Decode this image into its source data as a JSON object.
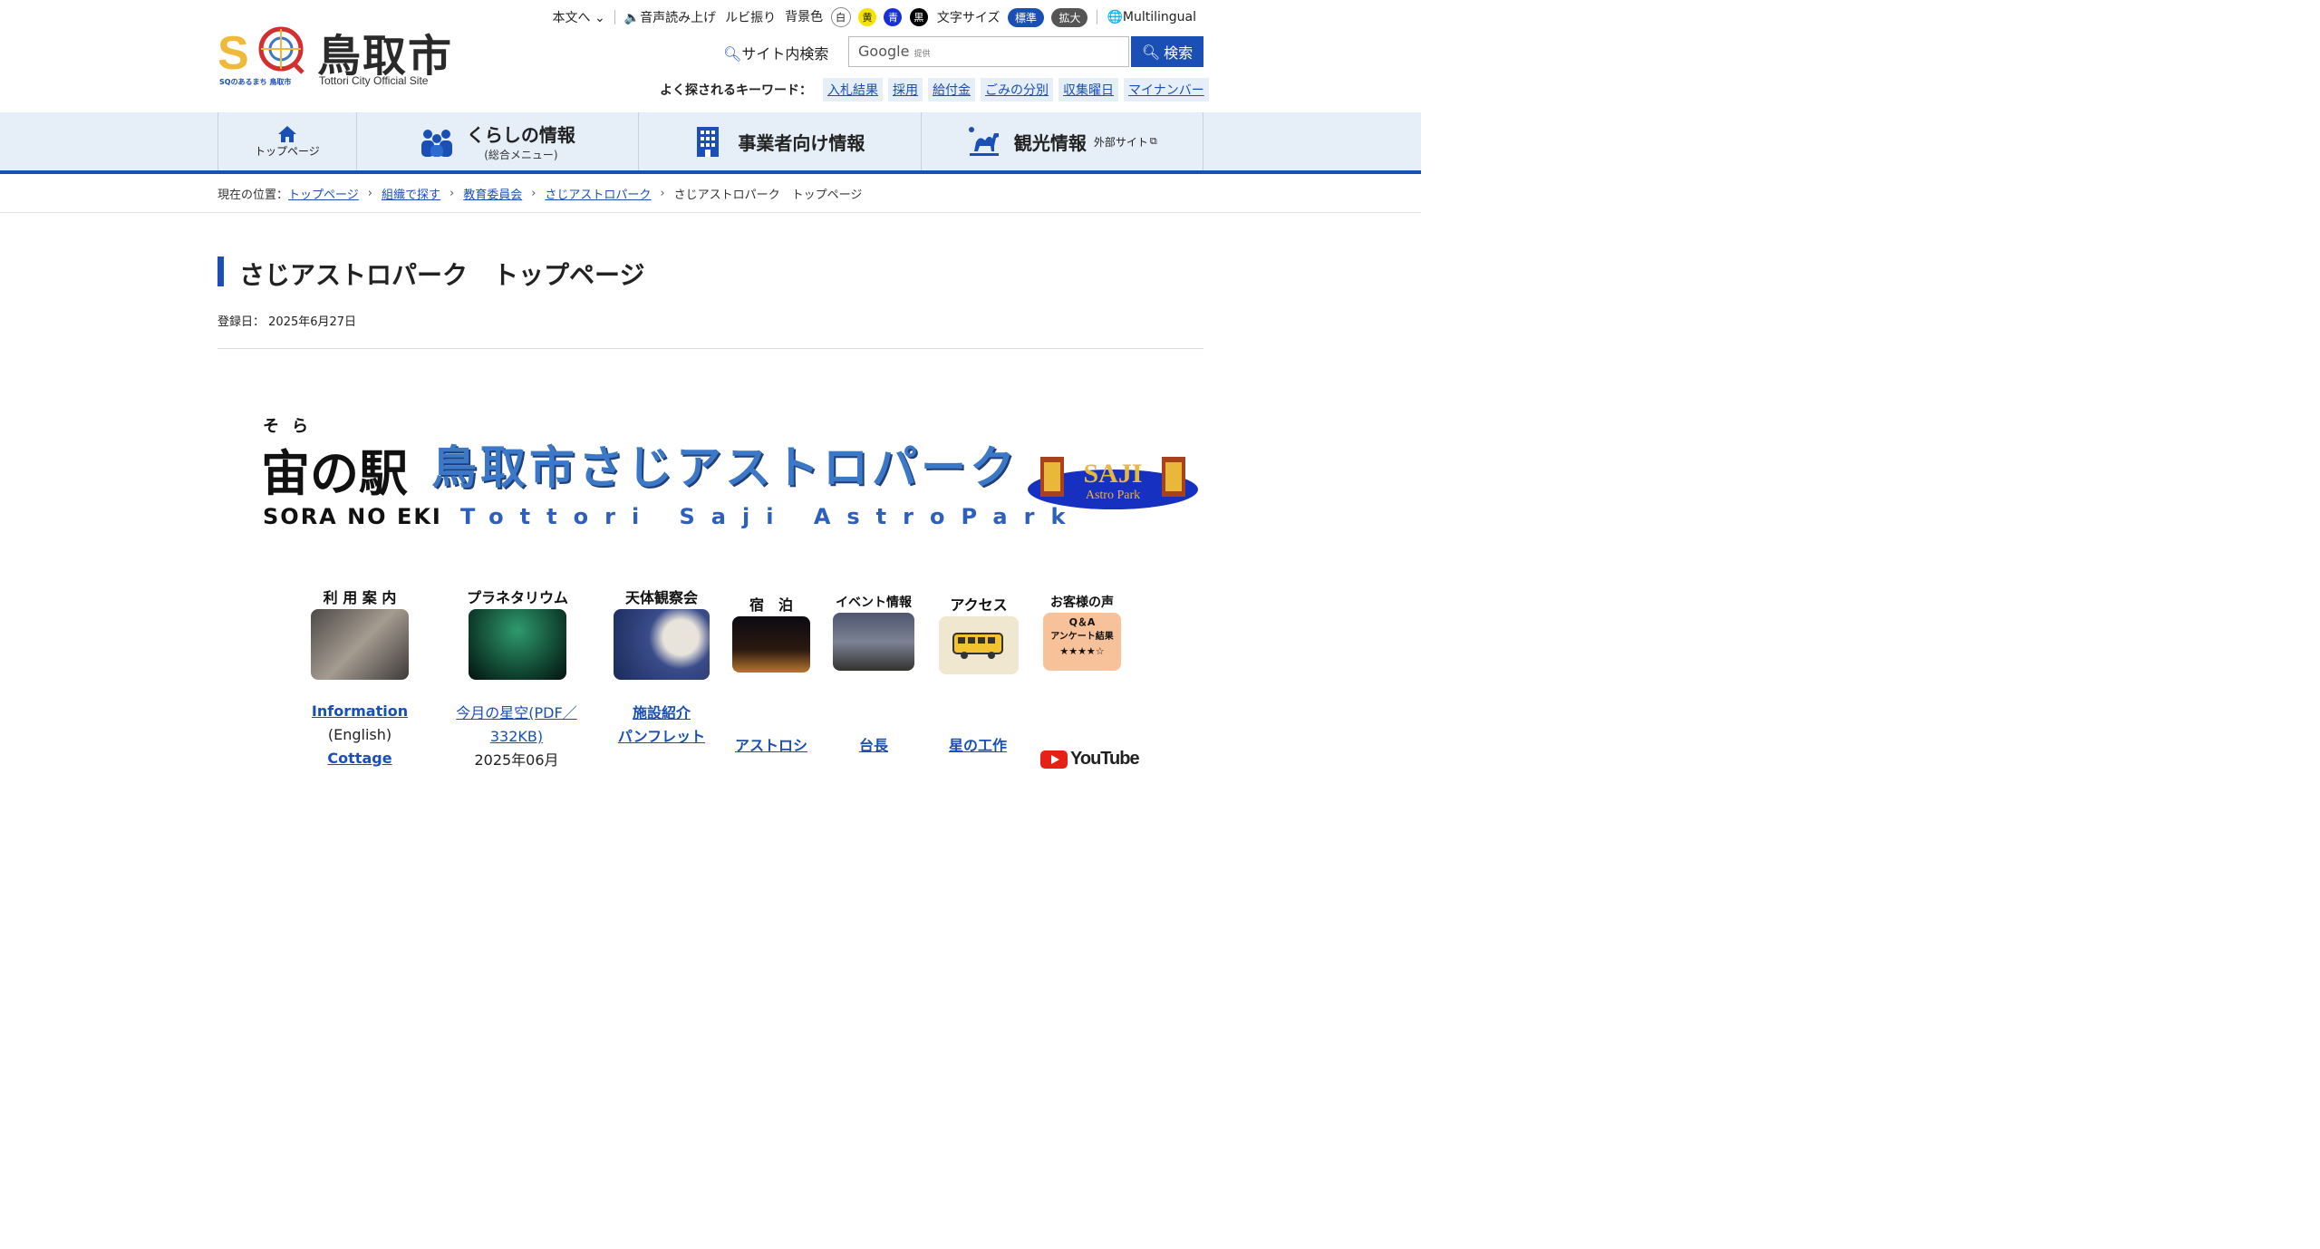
{
  "header": {
    "logo_name": "鳥取市",
    "logo_en": "Tottori City Official Site",
    "logo_sub": "SQのあるまち 鳥取市",
    "skip_link": "本文へ",
    "voice": "音声読み上げ",
    "ruby": "ルビ振り",
    "bg_label": "背景色",
    "bg_options": [
      "白",
      "黄",
      "青",
      "黒"
    ],
    "font_label": "文字サイズ",
    "font_standard": "標準",
    "font_large": "拡大",
    "multilingual": "Multilingual",
    "search_label": "サイト内検索",
    "search_placeholder_brand": "Google",
    "search_placeholder_note": "提供",
    "search_button": "検索",
    "keywords_label": "よく探されるキーワード：",
    "keywords": [
      "入札結果",
      "採用",
      "給付金",
      "ごみの分別",
      "収集曜日",
      "マイナンバー"
    ]
  },
  "nav": {
    "home": "トップページ",
    "life_title": "くらしの情報",
    "life_sub": "(総合メニュー)",
    "business": "事業者向け情報",
    "tourism": "観光情報",
    "tourism_ext": "外部サイト"
  },
  "breadcrumb": {
    "label": "現在の位置：",
    "items": [
      "トップページ",
      "組織で探す",
      "教育委員会",
      "さじアストロパーク"
    ],
    "current": "さじアストロパーク　トップページ"
  },
  "page": {
    "title": "さじアストロパーク　トップページ",
    "registered_label": "登録日：",
    "registered_date": "2025年6月27日"
  },
  "banner": {
    "ruby": "そら",
    "main": "宙の駅",
    "romaji": "SORA NO EKI",
    "jp": "鳥取市さじアストロパーク",
    "en": "Tottori Saji AstroPark",
    "badge_title": "SAJI",
    "badge_sub": "Astro Park"
  },
  "tiles": [
    {
      "label": "利 用 案 内"
    },
    {
      "label": "プラネタリウム"
    },
    {
      "label": "天体観察会"
    },
    {
      "label": "宿　泊"
    },
    {
      "label": "イベント情報"
    },
    {
      "label": "アクセス"
    },
    {
      "label": "お客様の声",
      "img_text1": "Q＆A",
      "img_text2": "アンケート結果",
      "img_text3": "★★★★☆"
    }
  ],
  "links": {
    "information": "Information",
    "english": "(English)",
    "cottage": "Cottage",
    "starsky": "今月の星空(PDF／",
    "starsky_size": "332KB)",
    "starsky_date": "2025年06月",
    "facility": "施設紹介",
    "pamphlet": "パンフレット",
    "astroshi": "アストロシ",
    "daichou": "台長",
    "hoshi": "星の工作",
    "youtube": "YouTube"
  },
  "colors": {
    "accent": "#1a4fb5",
    "nav_bg": "#e6eef7"
  }
}
